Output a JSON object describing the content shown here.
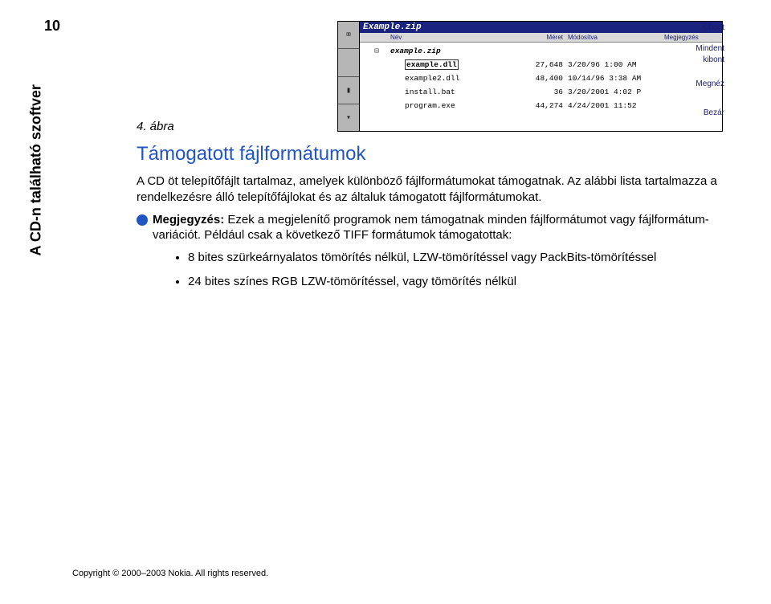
{
  "page_number": "10",
  "sidebar_title": "A CD-n található szoftver",
  "figure_caption": "4. ábra",
  "screenshot": {
    "title": "Example.zip",
    "toolbar": [
      "⌧",
      "",
      "▮",
      "▾"
    ],
    "columns": {
      "name": "Név",
      "size": "Méret",
      "modified": "Módosítva",
      "note": "Megjegyzés"
    },
    "rows": [
      {
        "tree": "⊟",
        "name": "example.zip",
        "top": true,
        "size": "",
        "mod": ""
      },
      {
        "tree": "",
        "name": "example.dll",
        "boxed": true,
        "size": "27,648",
        "mod": "3/20/96 1:00 AM"
      },
      {
        "tree": "",
        "name": "example2.dll",
        "size": "48,400",
        "mod": "10/14/96 3:38 AM"
      },
      {
        "tree": "",
        "name": "install.bat",
        "size": "36",
        "mod": "3/20/2001 4:02 P"
      },
      {
        "tree": "",
        "name": "program.exe",
        "size": "44,274",
        "mod": "4/24/2001 11:52"
      }
    ],
    "actions": {
      "a1": "Kibont",
      "a2a": "Mindent",
      "a2b": "kibont",
      "a3": "Megnéz",
      "a4": "Bezár"
    }
  },
  "section_title": "Támogatott fájlformátumok",
  "para1": "A CD öt telepítőfájlt tartalmaz, amelyek különböző fájlformátumokat támogatnak. Az alábbi lista tartalmazza a rendelkezésre álló telepítőfájlokat és az általuk támogatott fájlformátumokat.",
  "note_label": "Megjegyzés:",
  "note_body": " Ezek a megjelenítő programok nem támogatnak minden fájlformátumot vagy fájlformátum-variációt. Például csak a következő TIFF formátumok támogatottak:",
  "bullets": [
    "8 bites szürkeárnyalatos tömörítés nélkül, LZW-tömörítéssel vagy PackBits-tömörítéssel",
    "24 bites színes RGB LZW-tömörítéssel, vagy tömörítés nélkül"
  ],
  "copyright": "Copyright © 2000–2003 Nokia. All rights reserved."
}
